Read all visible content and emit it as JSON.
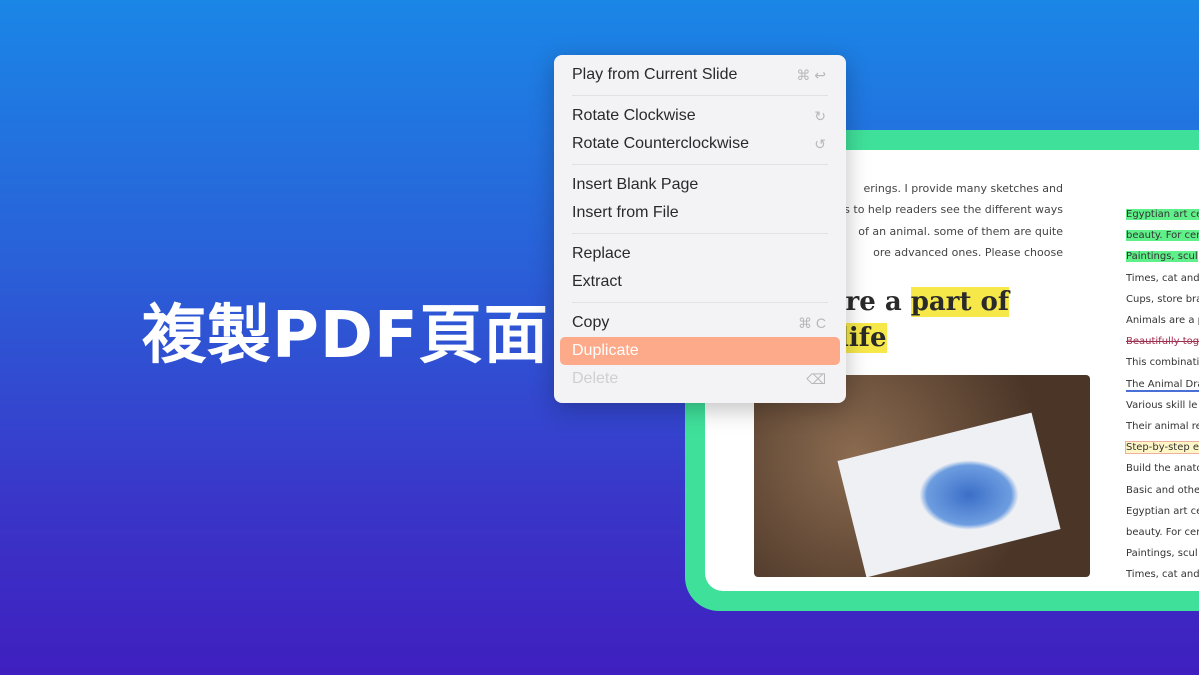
{
  "headline": "複製PDF頁面",
  "menu": {
    "items": [
      {
        "label": "Play from Current Slide",
        "shortcut": "⌘ ↩"
      },
      {
        "label": "Rotate Clockwise",
        "shortcut": "↻"
      },
      {
        "label": "Rotate Counterclockwise",
        "shortcut": "↺"
      },
      {
        "label": "Insert Blank Page"
      },
      {
        "label": "Insert from File"
      },
      {
        "label": "Replace"
      },
      {
        "label": "Extract"
      },
      {
        "label": "Copy",
        "shortcut": "⌘ C"
      },
      {
        "label": "Duplicate",
        "state": "highlighted"
      },
      {
        "label": "Delete",
        "shortcut": "⌫",
        "state": "disabled"
      }
    ],
    "highlight_color": "#fdaa8a"
  },
  "document": {
    "paragraph": [
      "erings. I provide many sketches and",
      "ples to help readers see the different ways",
      "of an animal. some of them are quite",
      "ore advanced ones. Please choose"
    ],
    "heading_line1_plain": "s are a ",
    "heading_line1_highlight": "part of",
    "heading_line2_highlight": "ly life",
    "side_lines": [
      "Egyptian art ce",
      "beauty. For cer",
      "Paintings, scul",
      "Times, cat and",
      "Cups, store bra",
      "Animals are a p",
      "Beautifully tog",
      "This combinati",
      "The Animal Dra",
      "Various skill le",
      "Their animal re",
      "Step-by-step ex",
      "Build the anato",
      "Basic and othe",
      "Egyptian art ce",
      "beauty. For cer",
      "Paintings, scul",
      "Times, cat and"
    ]
  },
  "colors": {
    "frame": "#3fe09a",
    "highlight_yellow": "#f7e84a",
    "highlight_green": "#5ff08a"
  }
}
